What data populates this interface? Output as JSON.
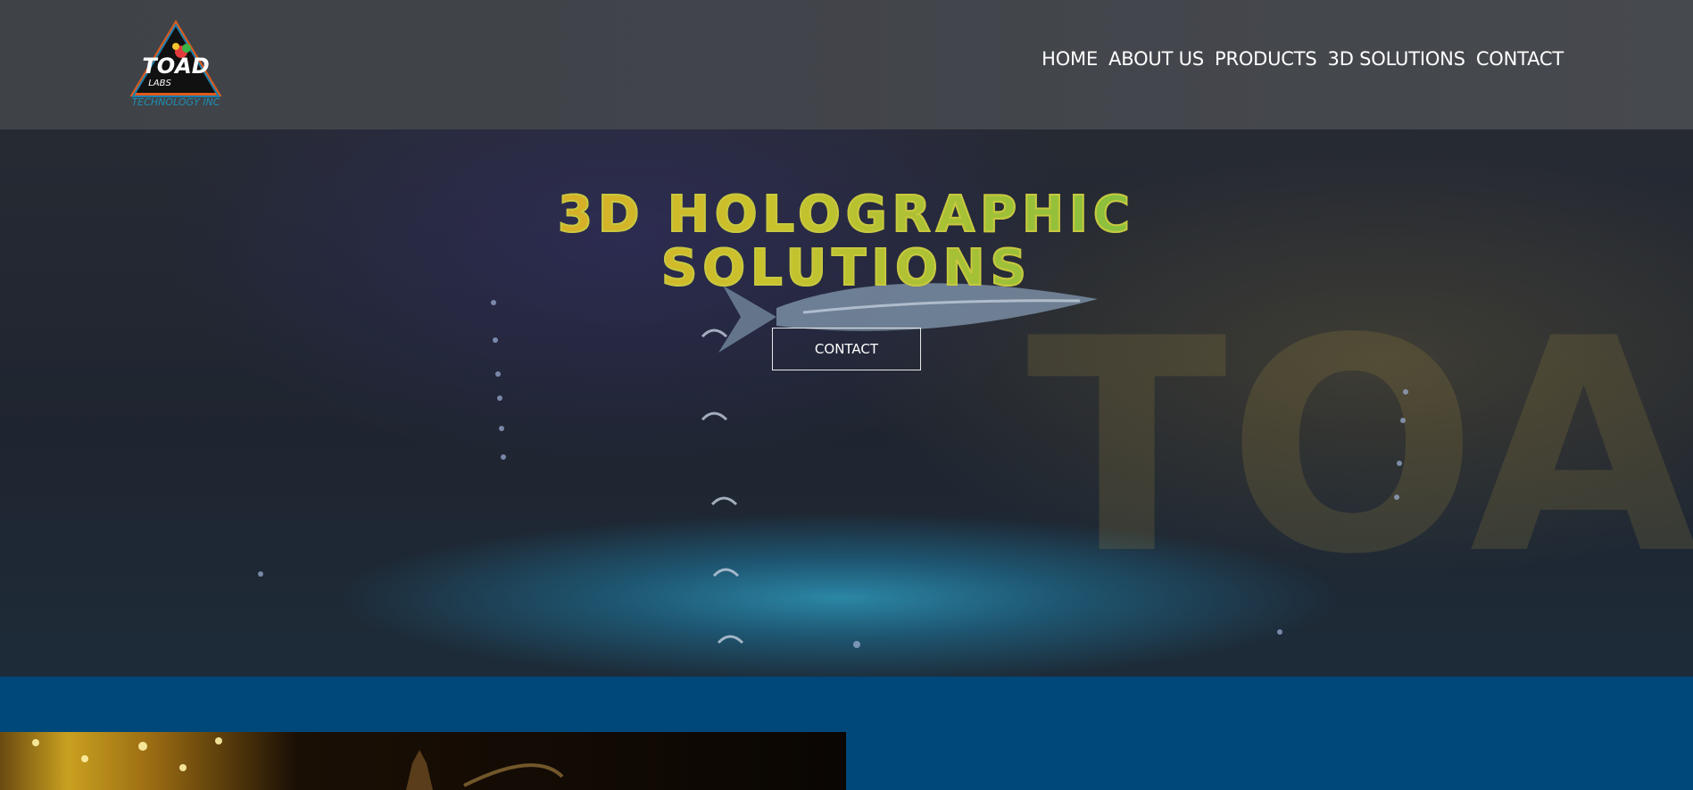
{
  "header": {
    "logo": {
      "brand": "TOAD",
      "sub": "LABS",
      "tagline": "TECHNOLOGY INC"
    },
    "nav": [
      "HOME",
      "ABOUT US",
      "PRODUCTS",
      "3D SOLUTIONS",
      "CONTACT"
    ]
  },
  "hero": {
    "title_line1": "3D HOLOGRAPHIC",
    "title_line2": "SOLUTIONS",
    "cta_label": "CONTACT",
    "background_watermark": "TOAD"
  },
  "colors": {
    "header_bg": "#414449",
    "band_blue": "#00477a",
    "title_gradient_start": "#e0581c",
    "title_gradient_end": "#2fae8d"
  }
}
